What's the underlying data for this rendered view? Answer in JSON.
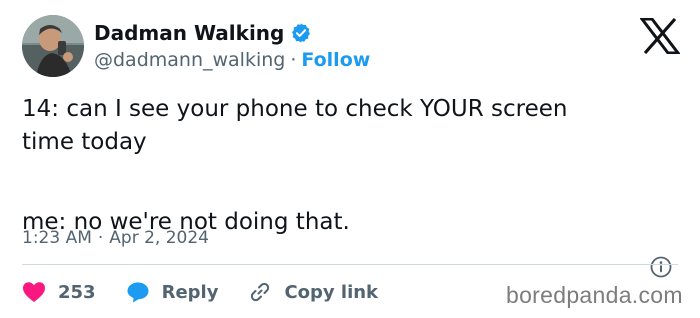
{
  "author": {
    "display_name": "Dadman Walking",
    "handle": "@dadmann_walking",
    "separator": "·",
    "follow_label": "Follow",
    "verified_color": "#1d9bf0"
  },
  "tweet": {
    "line1": "14: can I see your phone to check YOUR screen",
    "line2": "time today",
    "line3": "me: no we're not doing that."
  },
  "meta": {
    "time": "1:23 AM",
    "separator": "·",
    "date": "Apr 2, 2024"
  },
  "actions": {
    "like_count": "253",
    "reply_label": "Reply",
    "copy_label": "Copy link"
  },
  "icons": {
    "verified": "verified-badge-icon",
    "logo": "x-logo-icon",
    "info": "info-icon",
    "like": "heart-icon",
    "reply": "reply-bubble-icon",
    "copy": "link-icon"
  },
  "colors": {
    "accent": "#1d9bf0",
    "like": "#f91880",
    "muted": "#536471",
    "text": "#0f1419"
  },
  "watermark": "boredpanda.com"
}
